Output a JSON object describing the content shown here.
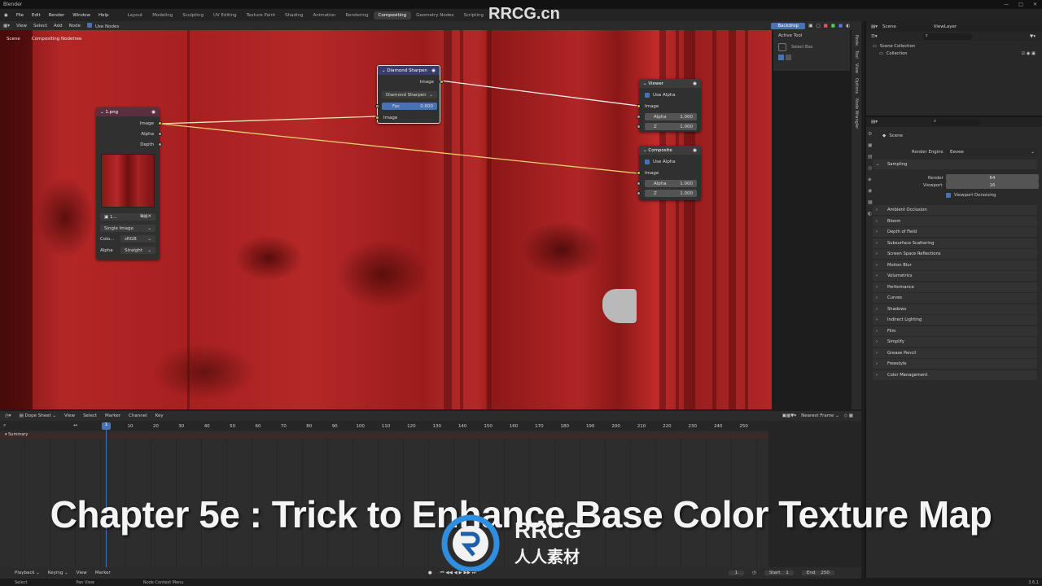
{
  "app_title": "Blender",
  "menu": [
    "File",
    "Edit",
    "Render",
    "Window",
    "Help"
  ],
  "workspaces": [
    "Layout",
    "Modeling",
    "Sculpting",
    "UV Editing",
    "Texture Paint",
    "Shading",
    "Animation",
    "Rendering",
    "Compositing",
    "Geometry Nodes",
    "Scripting",
    "+"
  ],
  "active_workspace": "Compositing",
  "node_editor": {
    "menus": [
      "View",
      "Select",
      "Add",
      "Node"
    ],
    "use_nodes": "Use Nodes",
    "backdrop": "Backdrop",
    "breadcrumb": [
      "Scene",
      "Compositing Nodetree"
    ],
    "nodes": {
      "image": {
        "title": "1.png",
        "out_image": "Image",
        "out_alpha": "Alpha",
        "out_depth": "Depth",
        "file_label": "1...",
        "source": "Single Image",
        "color_label": "Colo...",
        "color_value": "sRGB",
        "alpha_label": "Alpha",
        "alpha_value": "Straight"
      },
      "sharpen": {
        "title": "Diamond Sharpen",
        "out_image": "Image",
        "mode": "Diamond Sharpen",
        "fac_label": "Fac",
        "fac_value": "0.600",
        "in_image": "Image"
      },
      "viewer": {
        "title": "Viewer",
        "use_alpha": "Use Alpha",
        "in_image": "Image",
        "alpha_label": "Alpha",
        "alpha_value": "1.000",
        "z_label": "Z",
        "z_value": "1.000"
      },
      "composite": {
        "title": "Composite",
        "use_alpha": "Use Alpha",
        "in_image": "Image",
        "alpha_label": "Alpha",
        "alpha_value": "1.000",
        "z_label": "Z",
        "z_value": "1.000"
      }
    },
    "side_tabs": [
      "Node",
      "Tool",
      "View",
      "Options",
      "Node Wrangler"
    ],
    "active_tool": {
      "title": "Active Tool",
      "tool": "Select Box"
    }
  },
  "outliner": {
    "scene": "Scene",
    "view_layer": "ViewLayer",
    "items": [
      "Scene Collection",
      "Collection"
    ]
  },
  "properties": {
    "scene": "Scene",
    "render_engine_label": "Render Engine",
    "render_engine_value": "Eevee",
    "sampling": {
      "title": "Sampling",
      "render_label": "Render",
      "render_value": "64",
      "viewport_label": "Viewport",
      "viewport_value": "16",
      "denoise": "Viewport Denoising"
    },
    "sections": [
      "Ambient Occlusion",
      "Bloom",
      "Depth of Field",
      "Subsurface Scattering",
      "Screen Space Reflections",
      "Motion Blur",
      "Volumetrics",
      "Performance",
      "Curves",
      "Shadows",
      "Indirect Lighting",
      "Film",
      "Simplify",
      "Grease Pencil",
      "Freestyle",
      "Color Management"
    ]
  },
  "dope_sheet": {
    "mode": "Dope Sheet",
    "menus": [
      "View",
      "Select",
      "Marker",
      "Channel",
      "Key"
    ],
    "snap": "Nearest Frame",
    "current_frame": "1",
    "ticks": [
      "10",
      "20",
      "30",
      "40",
      "50",
      "60",
      "70",
      "80",
      "90",
      "100",
      "110",
      "120",
      "130",
      "140",
      "150",
      "160",
      "170",
      "180",
      "190",
      "200",
      "210",
      "220",
      "230",
      "240",
      "250"
    ],
    "summary": "Summary"
  },
  "timeline": {
    "menus": [
      "Playback",
      "Keying",
      "View",
      "Marker"
    ],
    "frame": "1",
    "start_label": "Start",
    "start_value": "1",
    "end_label": "End",
    "end_value": "250"
  },
  "status_bar": {
    "items": [
      "Select",
      "Pan View",
      "Node Context Menu"
    ],
    "version": "3.6.1"
  },
  "overlay": {
    "chapter_title": "Chapter 5e : Trick to Enhance Base Color Texture Map",
    "watermark_top": "RRCG.cn",
    "watermark_logo_text": "RRCG",
    "watermark_logo_sub": "人人素材"
  },
  "colors": {
    "accent": "#4772b3",
    "canvas_red": "#b02525",
    "socket_yellow": "#c7c729",
    "wire": "#e8e8b8",
    "active_tab": "#3d3d3d"
  }
}
